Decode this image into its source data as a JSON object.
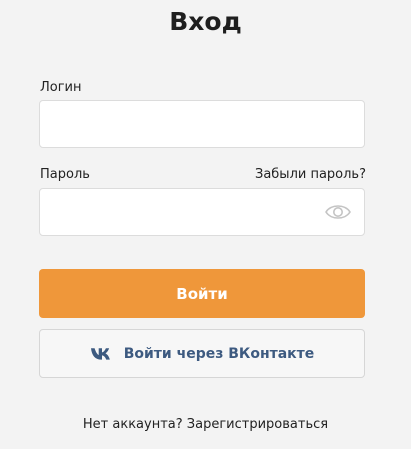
{
  "form": {
    "title": "Вход",
    "login_label": "Логин",
    "login_value": "",
    "password_label": "Пароль",
    "password_value": "",
    "forgot_link": "Забыли пароль?",
    "submit_label": "Войти",
    "vk_label": "Войти через ВКонтакте",
    "no_account_text": "Нет аккаунта?",
    "register_link": "Зарегистрироваться"
  },
  "icons": {
    "password_toggle": "eye-icon",
    "vk": "vk-logo-icon"
  },
  "colors": {
    "primary_button": "#ef973a",
    "vk_text": "#3d5a80",
    "background": "#f3f3f3"
  }
}
